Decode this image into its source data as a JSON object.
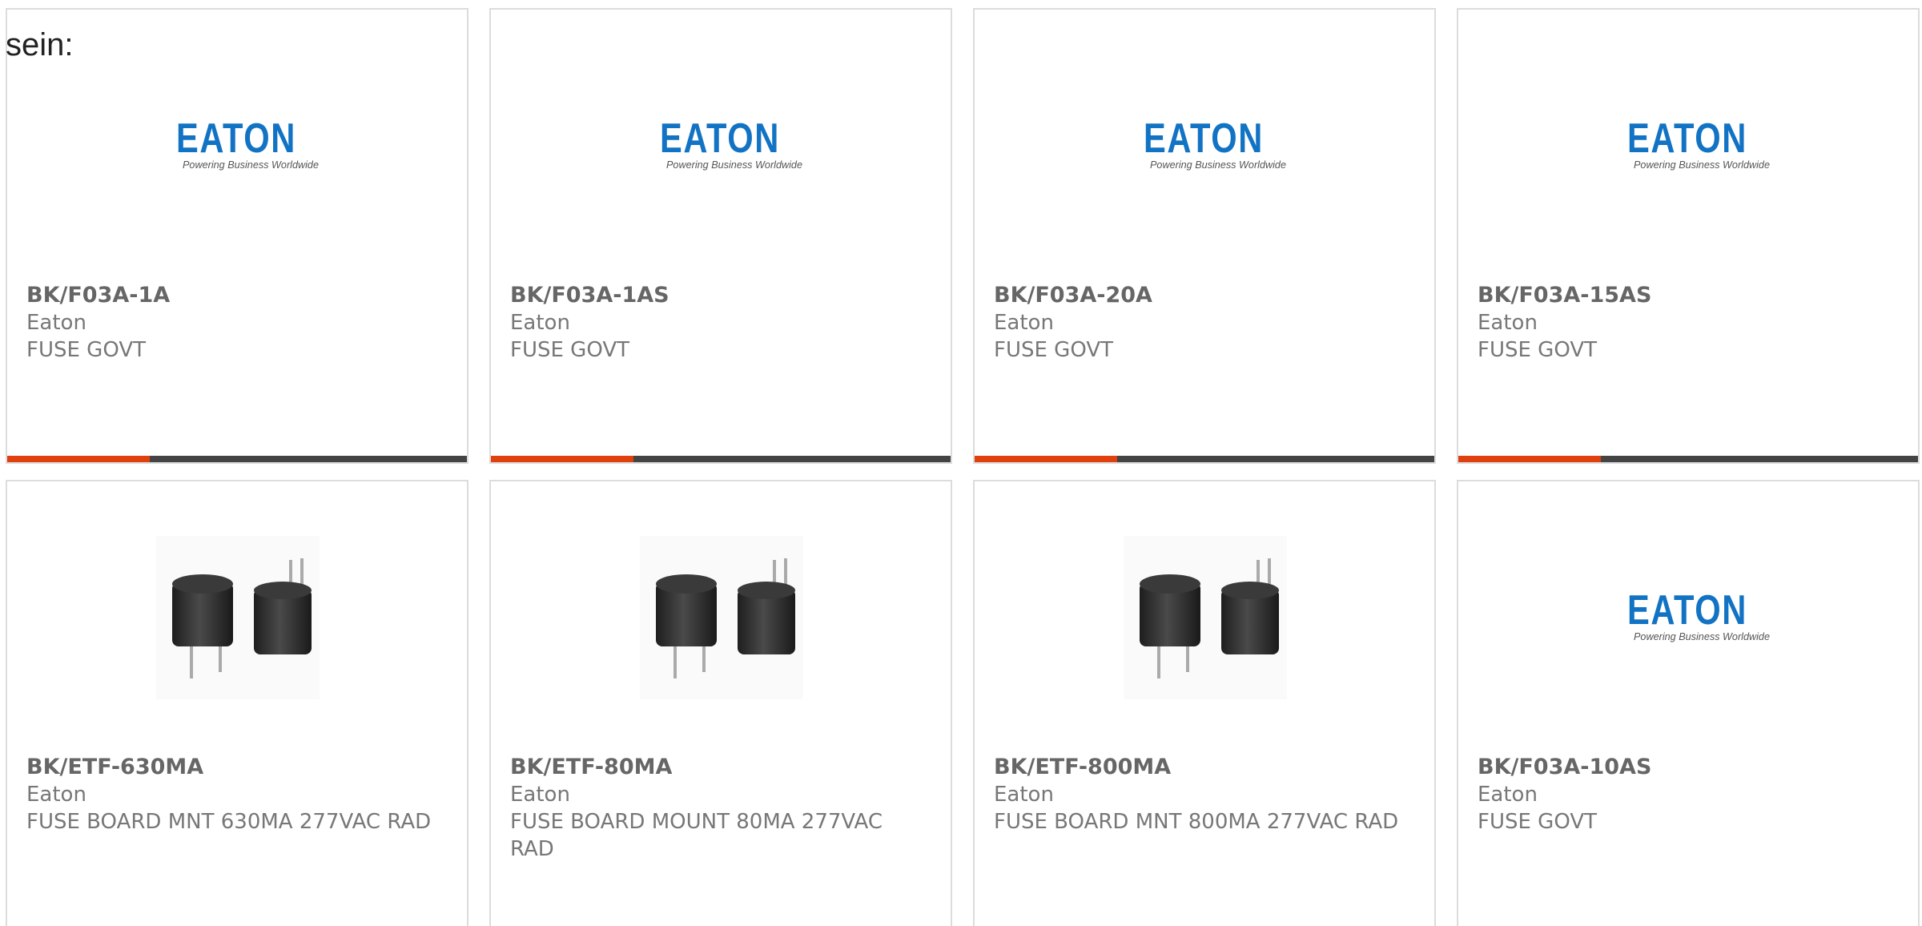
{
  "intro_text": "sein:",
  "brand": {
    "logo_word": "EATON",
    "logo_tagline": "Powering Business Worldwide",
    "logo_color": "#1273c4",
    "accent_color": "#e0400e",
    "bar_color": "#444444"
  },
  "products": [
    {
      "part_number": "BK/F03A-1A",
      "manufacturer": "Eaton",
      "description": "FUSE GOVT",
      "image": "eaton-logo",
      "progress": 0.31
    },
    {
      "part_number": "BK/F03A-1AS",
      "manufacturer": "Eaton",
      "description": "FUSE GOVT",
      "image": "eaton-logo",
      "progress": 0.31
    },
    {
      "part_number": "BK/F03A-20A",
      "manufacturer": "Eaton",
      "description": "FUSE GOVT",
      "image": "eaton-logo",
      "progress": 0.31
    },
    {
      "part_number": "BK/F03A-15AS",
      "manufacturer": "Eaton",
      "description": "FUSE GOVT",
      "image": "eaton-logo",
      "progress": 0.31
    },
    {
      "part_number": "BK/ETF-630MA",
      "manufacturer": "Eaton",
      "description": "FUSE BOARD MNT 630MA 277VAC RAD",
      "image": "fuse-photo"
    },
    {
      "part_number": "BK/ETF-80MA",
      "manufacturer": "Eaton",
      "description": "FUSE BOARD MOUNT 80MA 277VAC RAD",
      "image": "fuse-photo"
    },
    {
      "part_number": "BK/ETF-800MA",
      "manufacturer": "Eaton",
      "description": "FUSE BOARD MNT 800MA 277VAC RAD",
      "image": "fuse-photo"
    },
    {
      "part_number": "BK/F03A-10AS",
      "manufacturer": "Eaton",
      "description": "FUSE GOVT",
      "image": "eaton-logo"
    }
  ]
}
